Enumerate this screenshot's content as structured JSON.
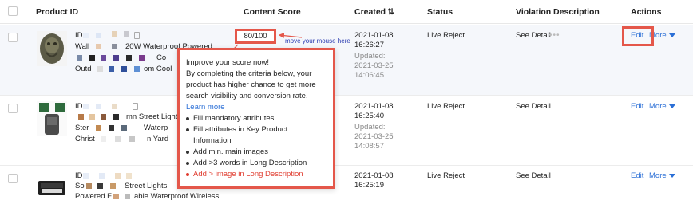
{
  "header": {
    "product_id": "Product ID",
    "content_score": "Content Score",
    "created": "Created",
    "status": "Status",
    "violation_description": "Violation Description",
    "actions": "Actions"
  },
  "rows": [
    {
      "id_prefix": "ID",
      "title_line1": "Wall",
      "title_line1b": "20W Waterproof Powered",
      "title_line2b": "Co",
      "title_line3": "Outd",
      "title_line3b": "om Cool",
      "score": "80/100",
      "created_date": "2021-01-08",
      "created_time": "16:26:27",
      "updated_label": "Updated:",
      "updated_date": "2021-03-25",
      "updated_time": "14:06:45",
      "status": "Live Reject",
      "violation": "See Detail",
      "violation_dots": "•••",
      "edit": "Edit",
      "more": "More"
    },
    {
      "id_prefix": "ID",
      "title_line1b": "mn Street Lights",
      "title_line2": "Ster",
      "title_line2b": "Waterp",
      "title_line3": "Christ",
      "title_line3b": "n Yard",
      "created_date": "2021-01-08",
      "created_time": "16:25:40",
      "updated_label": "Updated:",
      "updated_date": "2021-03-25",
      "updated_time": "14:08:57",
      "status": "Live Reject",
      "violation": "See Detail",
      "edit": "Edit",
      "more": "More"
    },
    {
      "id_prefix": "ID",
      "title_line1": "So",
      "title_line1b": "Street Lights",
      "title_line2": "Powered F",
      "title_line2b": "able Waterproof Wireless",
      "created_date": "2021-01-08",
      "created_time": "16:25:19",
      "status": "Live Reject",
      "violation": "See Detail",
      "edit": "Edit",
      "more": "More"
    }
  ],
  "annotation": "move your mouse here",
  "tooltip": {
    "heading": "Improve your score now!",
    "body": "By completing the criteria below, your product has higher chance to get more search visibility and conversion rate.",
    "learn_more": "Learn more",
    "items": [
      "Fill mandatory attributes",
      "Fill attributes in Key Product Information",
      "Add min. main images",
      "Add >3 words in Long Description",
      "Add > image in Long Description"
    ]
  },
  "colors": {
    "highlight_box": "#e4574a",
    "link": "#2b6fd6",
    "annotation": "#2a3bb0",
    "incomplete_item": "#e03b2e"
  }
}
